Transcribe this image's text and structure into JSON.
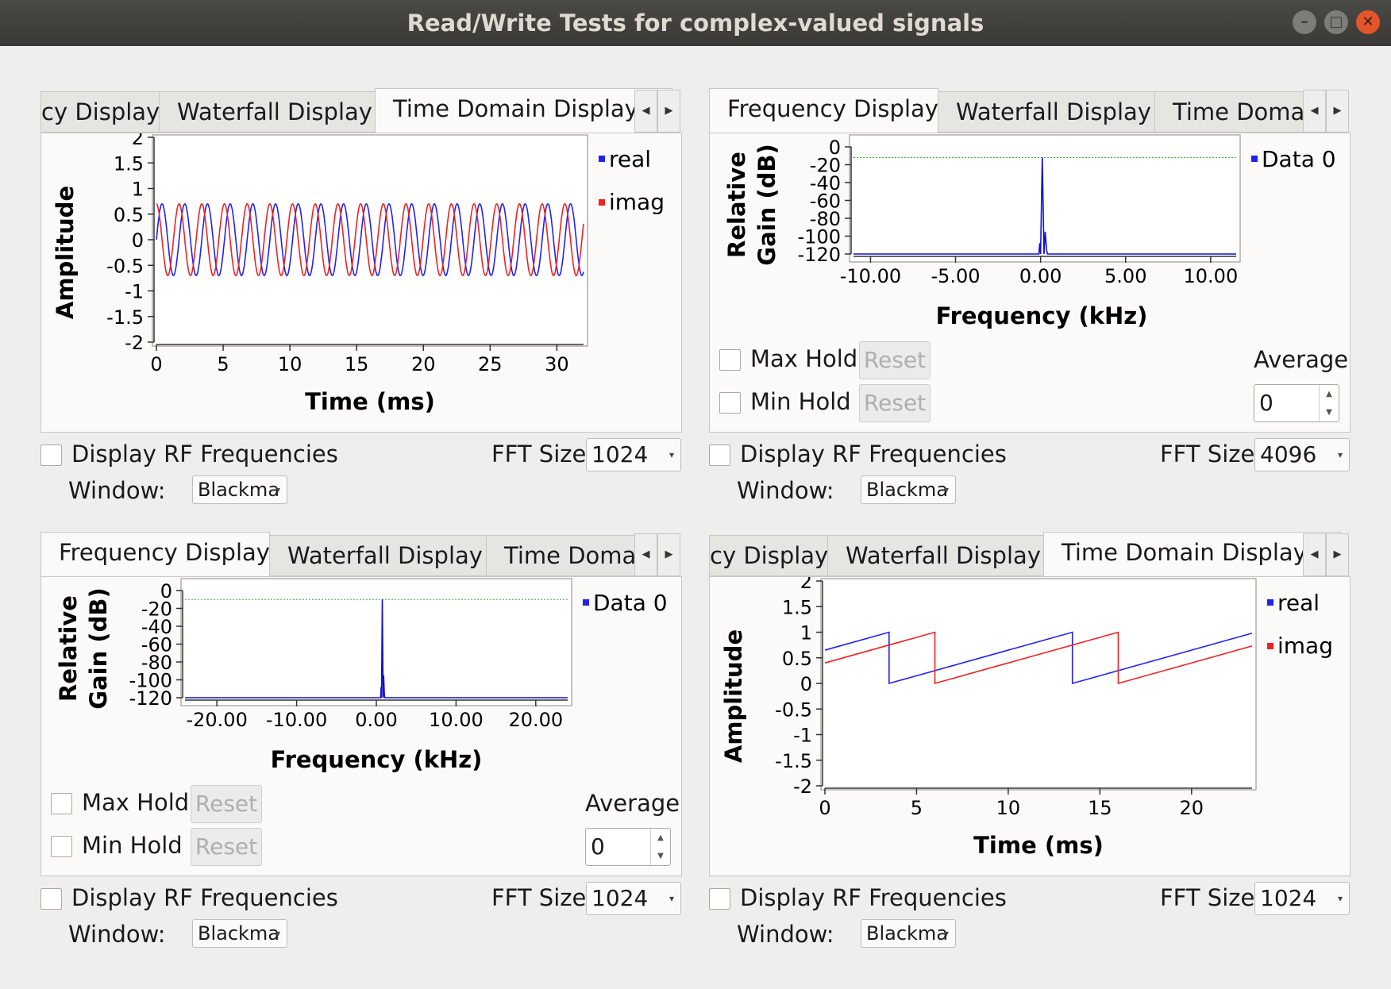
{
  "window": {
    "title": "Read/Write Tests for complex-valued signals"
  },
  "panels": {
    "tl": {
      "tabs": [
        "cy Display",
        "Waterfall Display",
        "Time Domain Display"
      ],
      "active_tab": 2,
      "chart": {
        "type": "line",
        "ylabel": "Amplitude",
        "xlabel": "Time (ms)",
        "yticks": [
          "2",
          "1.5",
          "1",
          "0.5",
          "0",
          "-0.5",
          "-1",
          "-1.5",
          "-2"
        ],
        "xticks": [
          "0",
          "5",
          "10",
          "15",
          "20",
          "25",
          "30"
        ],
        "legend": [
          "real",
          "imag"
        ]
      },
      "display_rf": "Display RF Frequencies",
      "fft_label": "FFT Size:",
      "fft_size": "1024",
      "window_label": "Window:",
      "window_value": "Blackma"
    },
    "tr": {
      "tabs": [
        "Frequency Display",
        "Waterfall Display",
        "Time Domai"
      ],
      "active_tab": 0,
      "chart": {
        "type": "line",
        "ylabel1": "Relative",
        "ylabel2": "Gain (dB)",
        "xlabel": "Frequency (kHz)",
        "yticks": [
          "0",
          "-20",
          "-40",
          "-60",
          "-80",
          "-100",
          "-120"
        ],
        "xticks": [
          "-10.00",
          "-5.00",
          "0.00",
          "5.00",
          "10.00"
        ],
        "legend": [
          "Data 0"
        ]
      },
      "max_hold": "Max Hold",
      "min_hold": "Min Hold",
      "reset": "Reset",
      "average_label": "Average",
      "average_value": "0",
      "display_rf": "Display RF Frequencies",
      "fft_label": "FFT Size:",
      "fft_size": "4096",
      "window_label": "Window:",
      "window_value": "Blackma"
    },
    "bl": {
      "tabs": [
        "Frequency Display",
        "Waterfall Display",
        "Time Domai"
      ],
      "active_tab": 0,
      "chart": {
        "type": "line",
        "ylabel1": "Relative",
        "ylabel2": "Gain (dB)",
        "xlabel": "Frequency (kHz)",
        "yticks": [
          "0",
          "-20",
          "-40",
          "-60",
          "-80",
          "-100",
          "-120"
        ],
        "xticks": [
          "-20.00",
          "-10.00",
          "0.00",
          "10.00",
          "20.00"
        ],
        "legend": [
          "Data 0"
        ]
      },
      "max_hold": "Max Hold",
      "min_hold": "Min Hold",
      "reset": "Reset",
      "average_label": "Average",
      "average_value": "0",
      "display_rf": "Display RF Frequencies",
      "fft_label": "FFT Size:",
      "fft_size": "1024",
      "window_label": "Window:",
      "window_value": "Blackma"
    },
    "br": {
      "tabs": [
        "cy Display",
        "Waterfall Display",
        "Time Domain Display"
      ],
      "active_tab": 2,
      "chart": {
        "type": "line",
        "ylabel": "Amplitude",
        "xlabel": "Time (ms)",
        "yticks": [
          "2",
          "1.5",
          "1",
          "0.5",
          "0",
          "-0.5",
          "-1",
          "-1.5",
          "-2"
        ],
        "xticks": [
          "0",
          "5",
          "10",
          "15",
          "20"
        ],
        "legend": [
          "real",
          "imag"
        ]
      },
      "display_rf": "Display RF Frequencies",
      "fft_label": "FFT Size:",
      "fft_size": "1024",
      "window_label": "Window:",
      "window_value": "Blackma"
    }
  },
  "chart_data": [
    {
      "type": "line",
      "title": "",
      "xlabel": "Time (ms)",
      "ylabel": "Amplitude",
      "xlim": [
        0,
        32
      ],
      "ylim": [
        -2,
        2
      ],
      "series": [
        {
          "name": "real",
          "color": "#2222ee",
          "shape": "sine",
          "amplitude": 0.7,
          "period_ms": 1.7,
          "phase_deg": 0
        },
        {
          "name": "imag",
          "color": "#ee2222",
          "shape": "sine",
          "amplitude": 0.7,
          "period_ms": 1.7,
          "phase_deg": 90
        }
      ]
    },
    {
      "type": "line",
      "title": "",
      "xlabel": "Frequency (kHz)",
      "ylabel": "Relative Gain (dB)",
      "xlim": [
        -11,
        11.5
      ],
      "ylim": [
        -120,
        0
      ],
      "series": [
        {
          "name": "Data 0",
          "color": "#1111cc",
          "peak_khz": 0.15,
          "peak_db": -12,
          "floor_db": -120
        }
      ],
      "reference_line_db": -12
    },
    {
      "type": "line",
      "title": "",
      "xlabel": "Frequency (kHz)",
      "ylabel": "Relative Gain (dB)",
      "xlim": [
        -24,
        24
      ],
      "ylim": [
        -120,
        0
      ],
      "series": [
        {
          "name": "Data 0",
          "color": "#1111cc",
          "peak_khz": 0.8,
          "peak_db": -10,
          "floor_db": -120
        }
      ],
      "reference_line_db": -10
    },
    {
      "type": "line",
      "title": "",
      "xlabel": "Time (ms)",
      "ylabel": "Amplitude",
      "xlim": [
        0,
        23.3
      ],
      "ylim": [
        -2,
        2
      ],
      "series": [
        {
          "name": "real",
          "color": "#2222ee",
          "shape": "sawtooth",
          "min": 0.0,
          "max": 1.0,
          "period_ms": 10,
          "start_value": 0.65
        },
        {
          "name": "imag",
          "color": "#ee2222",
          "shape": "sawtooth",
          "min": 0.0,
          "max": 1.0,
          "period_ms": 10,
          "start_value": 0.4
        }
      ]
    }
  ]
}
